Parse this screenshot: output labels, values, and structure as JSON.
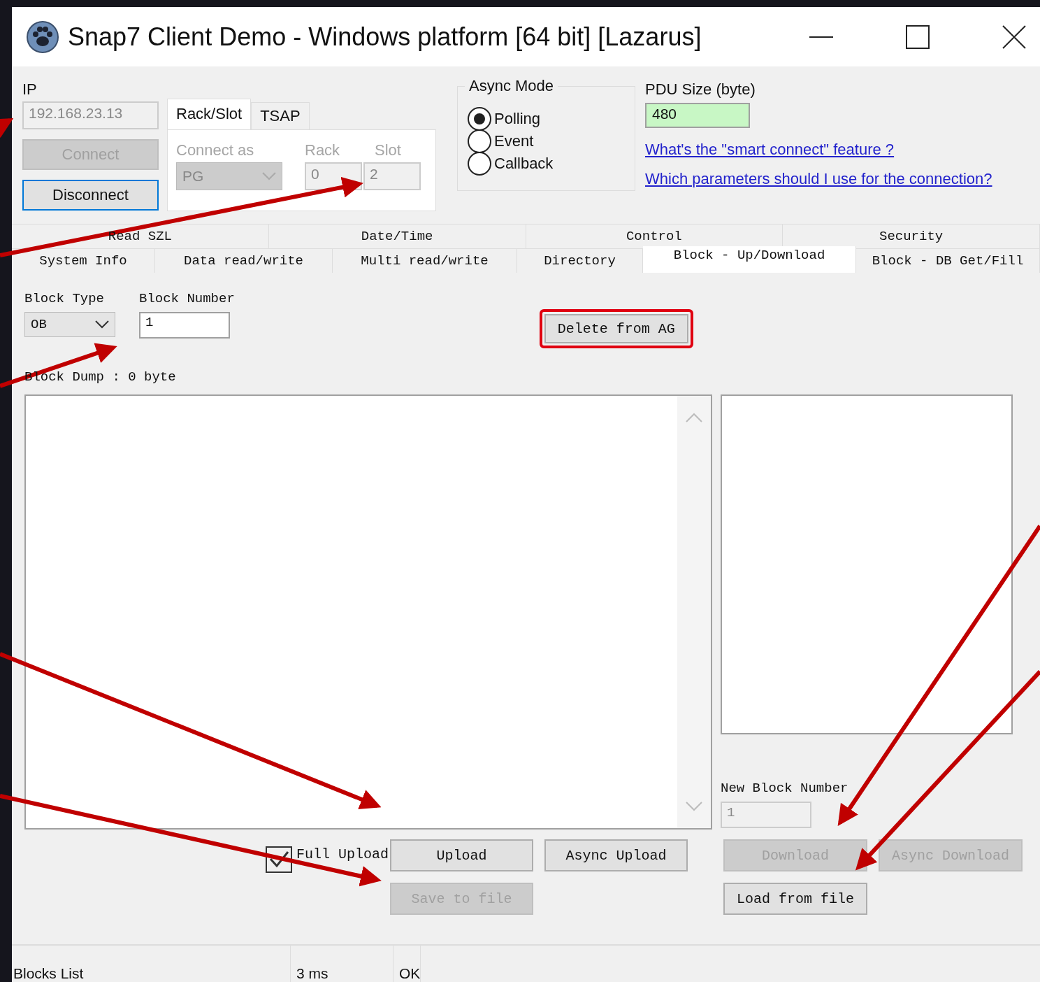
{
  "window": {
    "title": "Snap7 Client Demo - Windows platform [64 bit] [Lazarus]"
  },
  "connection": {
    "ip_label": "IP",
    "ip": "192.168.23.13",
    "buttons": [
      {
        "label": "Connect",
        "disabled": true,
        "focused": false
      },
      {
        "label": "Disconnect",
        "disabled": false,
        "focused": true
      }
    ]
  },
  "address_tabs": [
    {
      "label": "Rack/Slot",
      "selected": true
    },
    {
      "label": "TSAP",
      "selected": false
    }
  ],
  "rack_slot": {
    "disabled": true,
    "connect_as_label": "Connect as",
    "connect_as": "PG",
    "rack_label": "Rack",
    "rack": "0",
    "slot_label": "Slot",
    "slot": "2"
  },
  "async_mode": {
    "title": "Async Mode",
    "options": [
      {
        "label": "Polling",
        "selected": true
      },
      {
        "label": "Event",
        "selected": false
      },
      {
        "label": "Callback",
        "selected": false
      }
    ]
  },
  "pdu": {
    "label": "PDU Size (byte)",
    "value": "480"
  },
  "links": [
    "What's the \"smart connect\" feature ?",
    "Which parameters should I use for the connection?"
  ],
  "tabs": [
    [
      {
        "label": "Read SZL",
        "selected": false
      },
      {
        "label": "Date/Time",
        "selected": false
      },
      {
        "label": "Control",
        "selected": false
      },
      {
        "label": "Security",
        "selected": false
      }
    ],
    [
      {
        "label": "System Info",
        "selected": false
      },
      {
        "label": "Data read/write",
        "selected": false
      },
      {
        "label": "Multi read/write",
        "selected": false
      },
      {
        "label": "Directory",
        "selected": false
      },
      {
        "label": "Block - Up/Download",
        "selected": true
      },
      {
        "label": "Block - DB Get/Fill",
        "selected": false
      }
    ]
  ],
  "block": {
    "type_label": "Block Type",
    "type": "OB",
    "number_label": "Block Number",
    "number": "1",
    "delete_button": {
      "label": "Delete from AG",
      "highlighted": true
    },
    "dump_label": "Block Dump : 0 byte",
    "full_upload": {
      "label": "Full Upload",
      "checked": true
    },
    "upload_buttons": [
      {
        "label": "Upload",
        "disabled": false
      },
      {
        "label": "Async Upload",
        "disabled": false
      },
      {
        "label": "Save to file",
        "disabled": true
      }
    ],
    "new_block_label": "New Block Number",
    "new_block_number": "1",
    "download_buttons": [
      {
        "label": "Download",
        "disabled": true
      },
      {
        "label": "Async Download",
        "disabled": true
      },
      {
        "label": "Load from file",
        "disabled": false
      }
    ]
  },
  "status_bar": [
    "Blocks List",
    "3 ms",
    "OK"
  ]
}
